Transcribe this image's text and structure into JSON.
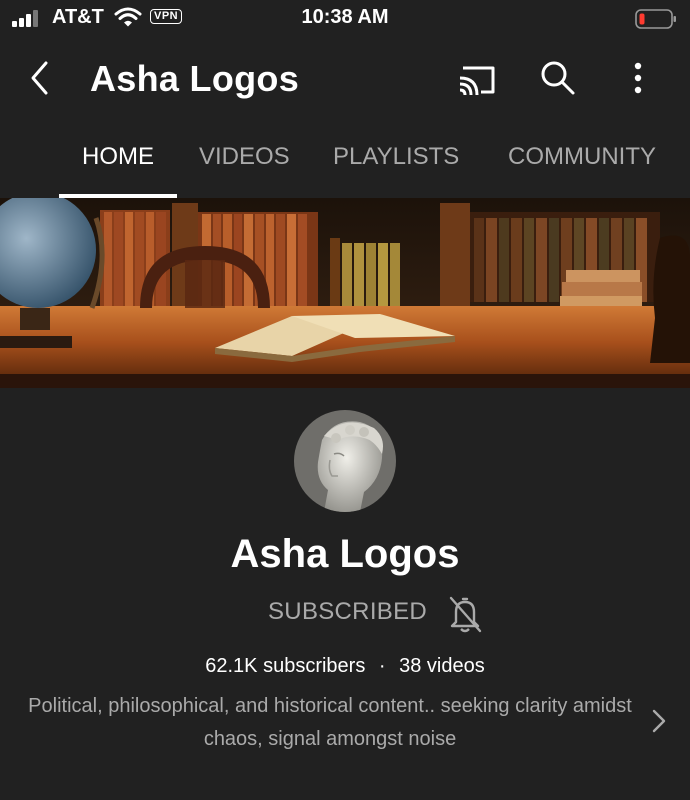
{
  "status_bar": {
    "carrier": "AT&T",
    "vpn": "VPN",
    "time": "10:38 AM",
    "battery_color": "#ff3b30"
  },
  "app_bar": {
    "title": "Asha Logos",
    "icons": [
      "back-arrow-icon",
      "cast-icon",
      "search-icon",
      "more-vert-icon"
    ]
  },
  "tabs": [
    {
      "label": "HOME",
      "active": true
    },
    {
      "label": "VIDEOS",
      "active": false
    },
    {
      "label": "PLAYLISTS",
      "active": false
    },
    {
      "label": "COMMUNITY",
      "active": false
    }
  ],
  "channel": {
    "name": "Asha Logos",
    "subscribe_label": "SUBSCRIBED",
    "subscribers": "62.1K subscribers",
    "separator": "·",
    "videos": "38 videos",
    "description": "Political, philosophical, and historical content.. seeking clarity amidst chaos, signal amongst noise"
  },
  "colors": {
    "background": "#212121",
    "secondary_text": "#aaaaaa",
    "primary_text": "#ffffff"
  }
}
